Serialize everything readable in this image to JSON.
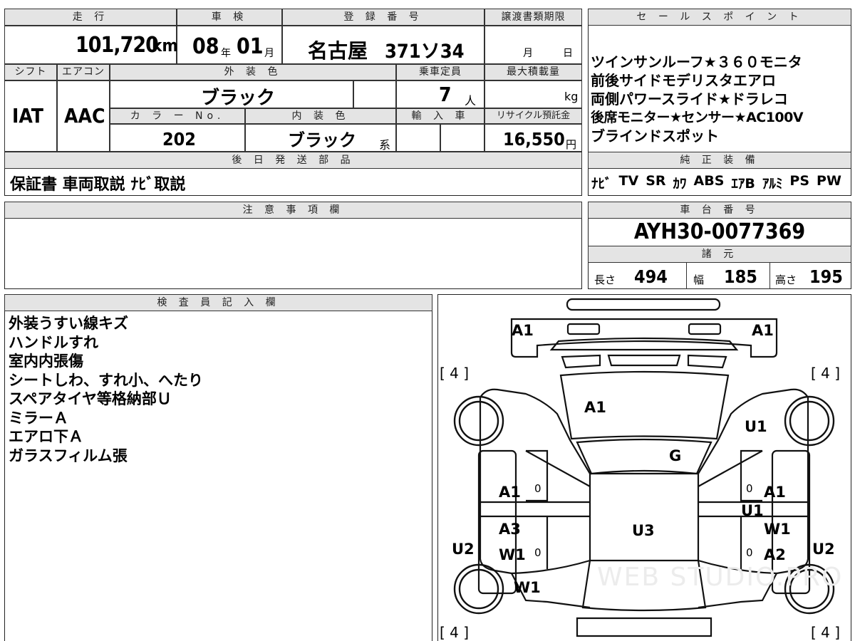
{
  "top_table": {
    "mileage_header": "走 行",
    "mileage_value": "101,720",
    "mileage_unit": "km",
    "inspection_header": "車 検",
    "inspection_year": "08",
    "inspection_year_unit": "年",
    "inspection_month": "01",
    "inspection_month_unit": "月",
    "registration_header": "登 録 番 号",
    "registration_city": "名古屋",
    "registration_number": "371ソ34",
    "transfer_header": "譲渡書類期限",
    "transfer_month_unit": "月",
    "transfer_day_unit": "日",
    "shift_header": "シフト",
    "shift_value": "IAT",
    "aircon_header": "エアコン",
    "aircon_value": "AAC",
    "exterior_color_header": "外 装 色",
    "exterior_color_value": "ブラック",
    "capacity_header": "乗車定員",
    "capacity_value": "7",
    "capacity_unit": "人",
    "max_load_header": "最大積載量",
    "max_load_unit": "kg",
    "color_no_header": "カ ラ ー No.",
    "color_no_value": "202",
    "interior_color_header": "内 装 色",
    "interior_color_value": "ブラック",
    "interior_color_suffix": "系",
    "import_header": "輸 入 車",
    "recycle_header": "リサイクル預託金",
    "recycle_value": "16,550",
    "recycle_unit": "円",
    "later_parts_header": "後 日 発 送 部 品",
    "later_parts_value": "保証書 車両取説 ﾅﾋﾞ取説"
  },
  "sales_points": {
    "header": "セ ー ル ス ポ イ ン ト",
    "lines": [
      "ツインサンルーフ★３６０モニタ",
      "前後サイドモデリスタエアロ",
      "両側パワースライド★ドラレコ",
      "後席モニター★センサー★AC100V",
      "ブラインドスポット"
    ]
  },
  "genuine_equipment": {
    "header": "純 正 装 備",
    "items": [
      "ﾅﾋﾞ",
      "TV",
      "SR",
      "ｶﾜ",
      "ABS",
      "ｴｱB",
      "ｱﾙﾐ",
      "PS",
      "PW"
    ]
  },
  "caution": {
    "header": "注 意 事 項 欄"
  },
  "chassis": {
    "header": "車 台 番 号",
    "value": "AYH30-0077369"
  },
  "dimensions": {
    "header": "諸 元",
    "length_label": "長さ",
    "length_value": "494",
    "width_label": "幅",
    "width_value": "185",
    "height_label": "高さ",
    "height_value": "195"
  },
  "inspector_notes": {
    "header": "検 査 員 記 入 欄",
    "lines": [
      "外装うすい線キズ",
      "ハンドルすれ",
      "室内内張傷",
      "シートしわ、すれ小、へたり",
      "スペアタイヤ等格納部Ｕ",
      "ミラーＡ",
      "エアロ下Ａ",
      "ガラスフィルム張"
    ]
  },
  "diagram": {
    "labels": {
      "front_left": "A1",
      "front_right": "A1",
      "hood": "A1",
      "right_front_fender": "U1",
      "windshield": "G",
      "left_front_door": "A1",
      "right_front_door": "A1",
      "right_pillar": "U1",
      "left_rear_door_a": "A3",
      "left_rear_door_w": "W1",
      "right_rear_door_w": "W1",
      "right_rear_door_a": "A2",
      "roof": "U3",
      "left_side": "U2",
      "right_side": "U2",
      "left_rear_fender": "W1"
    },
    "tire_front_left": "[ 4 ]",
    "tire_front_right": "[ 4 ]",
    "tire_rear_left": "[ 4 ]",
    "tire_rear_right": "[ 4 ]",
    "zero_marks": [
      "0",
      "0",
      "0",
      "0"
    ],
    "watermark": "WEB STUDIO.PRO"
  }
}
